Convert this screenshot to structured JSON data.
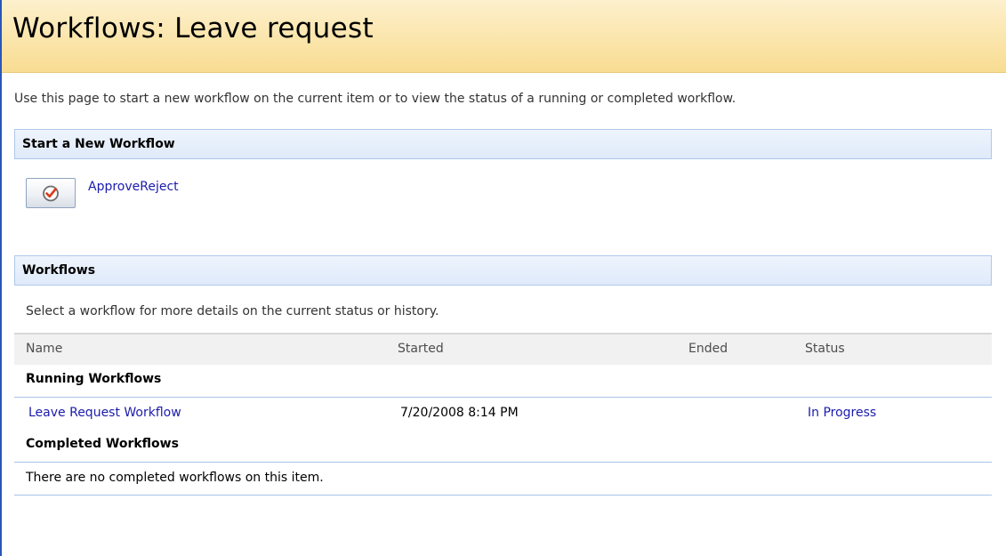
{
  "page": {
    "title": "Workflows: Leave request",
    "intro": "Use this page to start a new workflow on the current item or to view the status of a running or completed workflow."
  },
  "start_section": {
    "header": "Start a New Workflow",
    "workflow_name": "ApproveReject",
    "icon": "workflow-check-icon"
  },
  "workflows_section": {
    "header": "Workflows",
    "note": "Select a workflow for more details on the current status or history.",
    "columns": {
      "name": "Name",
      "started": "Started",
      "ended": "Ended",
      "status": "Status"
    },
    "running": {
      "label": "Running Workflows",
      "rows": [
        {
          "name": "Leave Request Workflow",
          "started": "7/20/2008 8:14 PM",
          "ended": "",
          "status": "In Progress"
        }
      ]
    },
    "completed": {
      "label": "Completed Workflows",
      "empty_message": "There are no completed workflows on this item."
    }
  },
  "colors": {
    "link": "#1b1bad",
    "title_bar": "#fae4a8",
    "section_header": "#dfeafa",
    "border_accent": "#2a56b8"
  }
}
